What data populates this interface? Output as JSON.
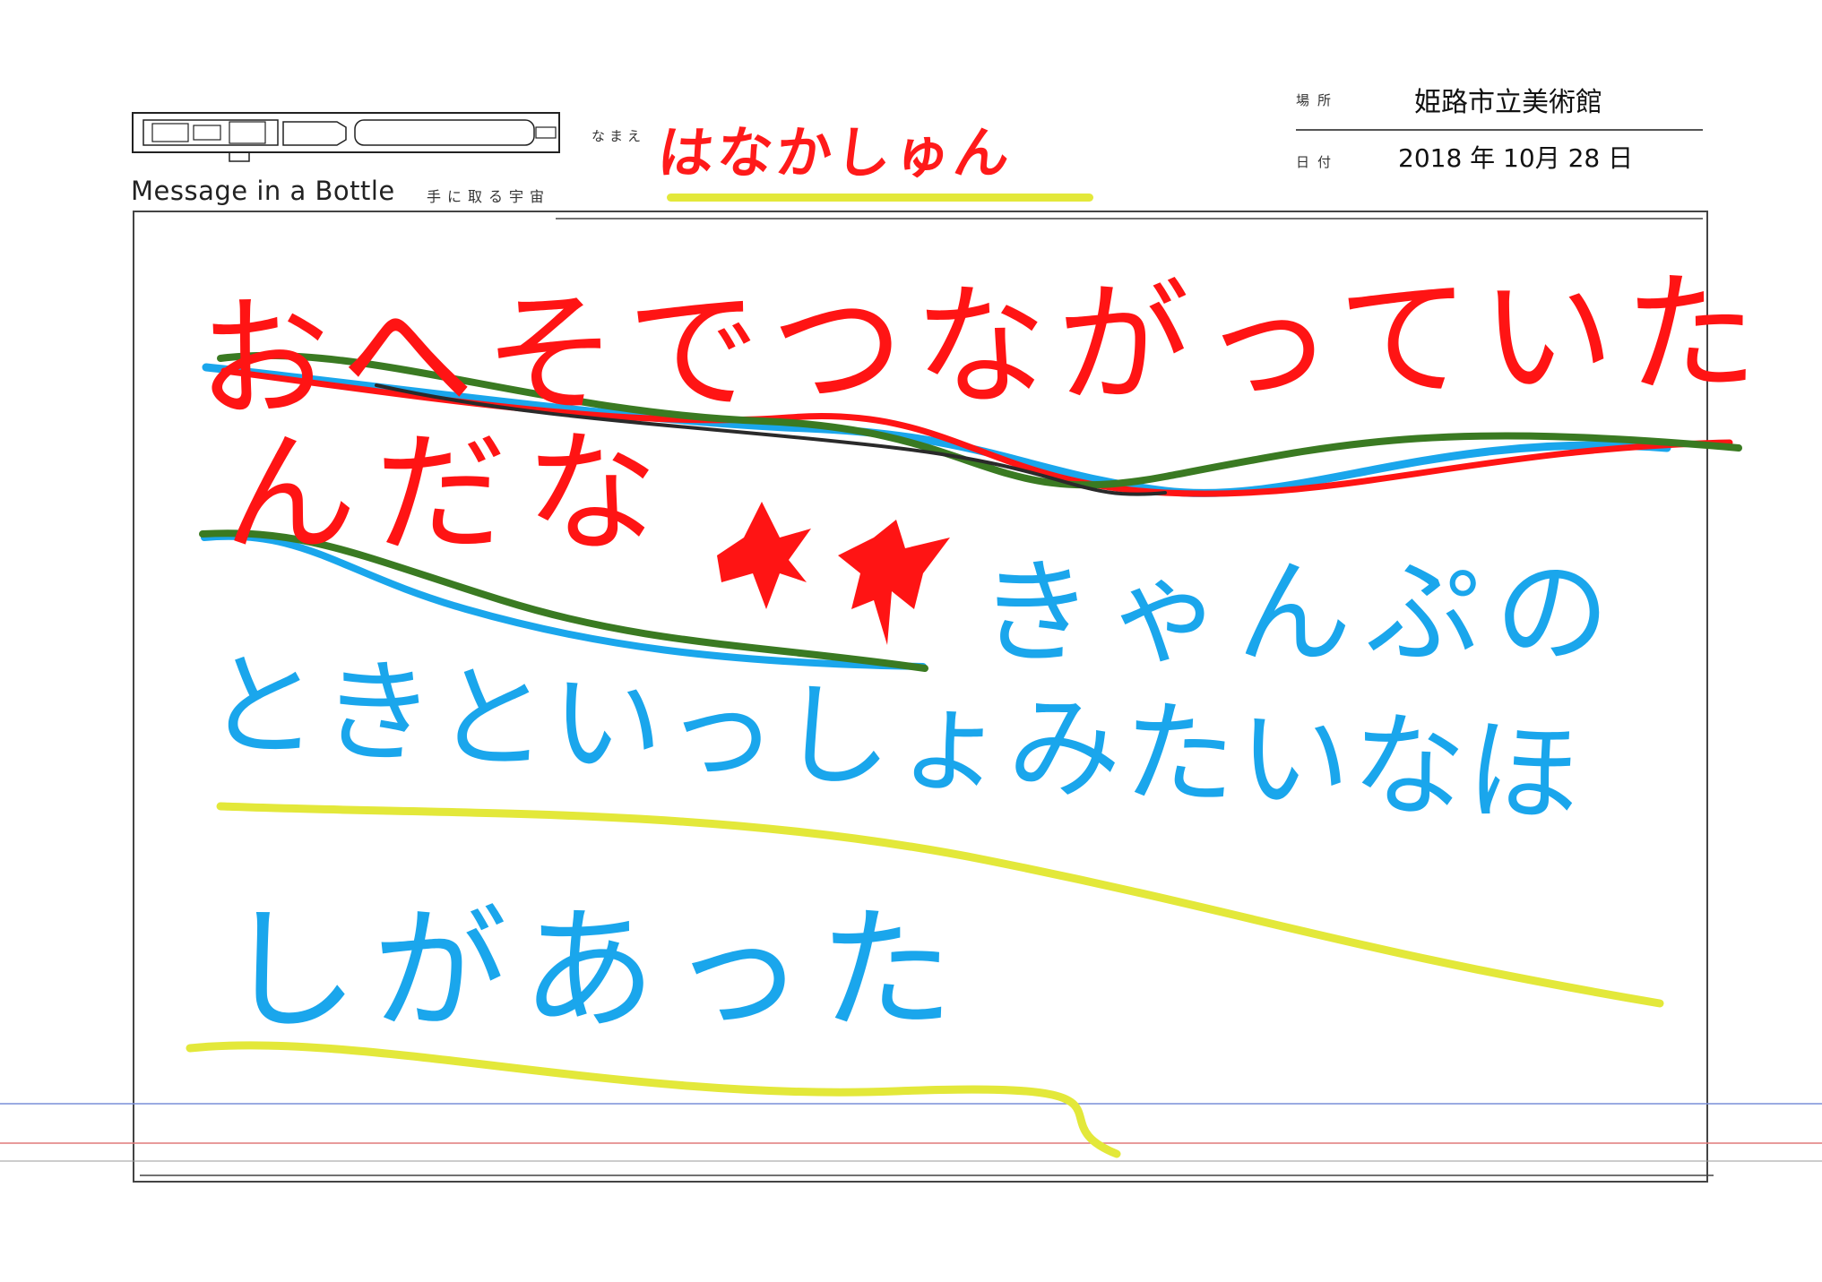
{
  "header": {
    "brand": "Message in a Bottle",
    "tagline": "手に取る宇宙",
    "name_label": "なまえ",
    "name_value": "はなかしゅん",
    "place_label": "場所",
    "place_value": "姫路市立美術館",
    "date_label": "日付",
    "date_value": "2018 年 10月 28 日"
  },
  "message": {
    "line1": "おへそでつながっていた",
    "line2": "んだな",
    "line3": "きゃんぷの",
    "line4": "ときといっしょみたいなほ",
    "line5": "しがあった"
  },
  "colors": {
    "red_ink": "#ff1414",
    "blue_ink": "#1aa6ec",
    "green_ink": "#3a7a22",
    "yellow_ink": "#e3e83a"
  },
  "icons": {
    "logo": "bottle-icon",
    "decoration": "red-star-icon"
  }
}
